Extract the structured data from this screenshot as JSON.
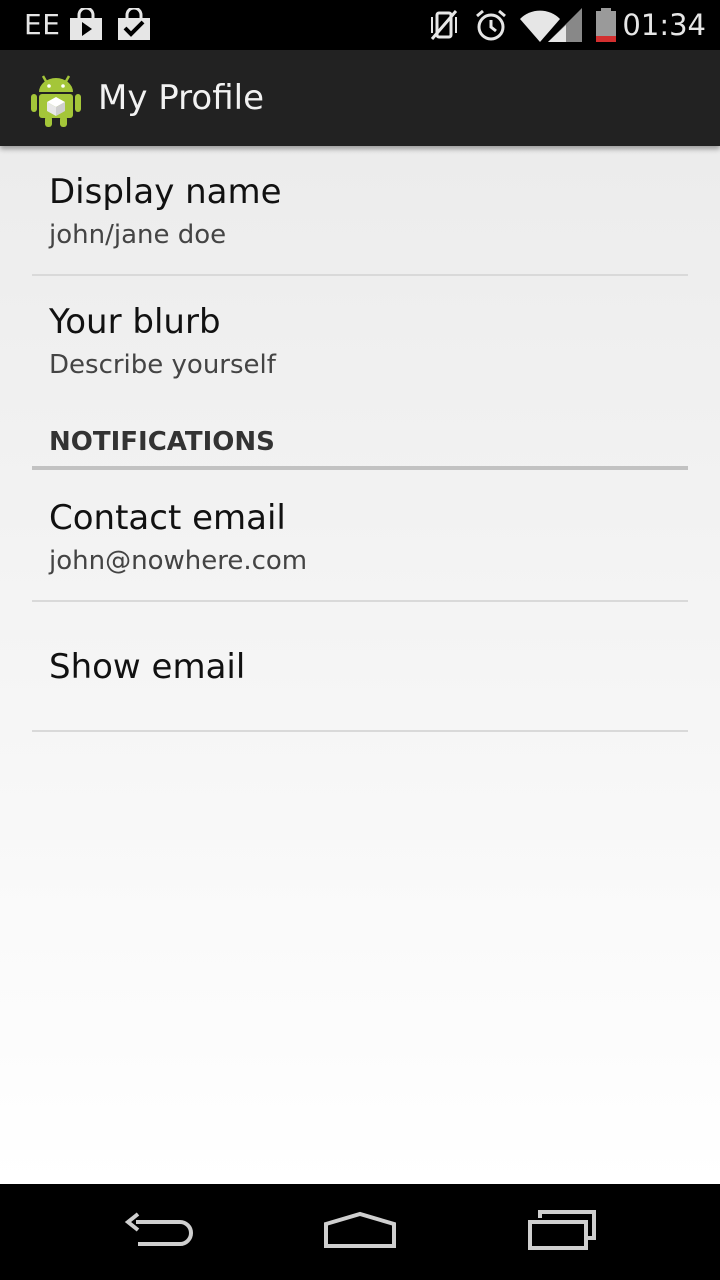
{
  "status_bar": {
    "carrier": "EE",
    "time": "01:34",
    "icons": [
      "shopping-bag-icon",
      "checkbox-bag-icon",
      "vibrate-off-icon",
      "alarm-icon",
      "wifi-icon",
      "signal-icon",
      "battery-icon"
    ],
    "battery_color": "#d32f2f"
  },
  "action_bar": {
    "title": "My Profile",
    "icon": "android-app-icon",
    "accent": "#a4c639"
  },
  "preferences": [
    {
      "title": "Display name",
      "summary": "john/jane doe"
    },
    {
      "title": "Your blurb",
      "summary": "Describe yourself"
    }
  ],
  "notifications": {
    "header": "NOTIFICATIONS",
    "items": [
      {
        "title": "Contact email",
        "summary": "john@nowhere.com"
      },
      {
        "title": "Show email"
      }
    ]
  },
  "nav_bar": {
    "buttons": [
      "back-icon",
      "home-icon",
      "recent-apps-icon"
    ]
  }
}
